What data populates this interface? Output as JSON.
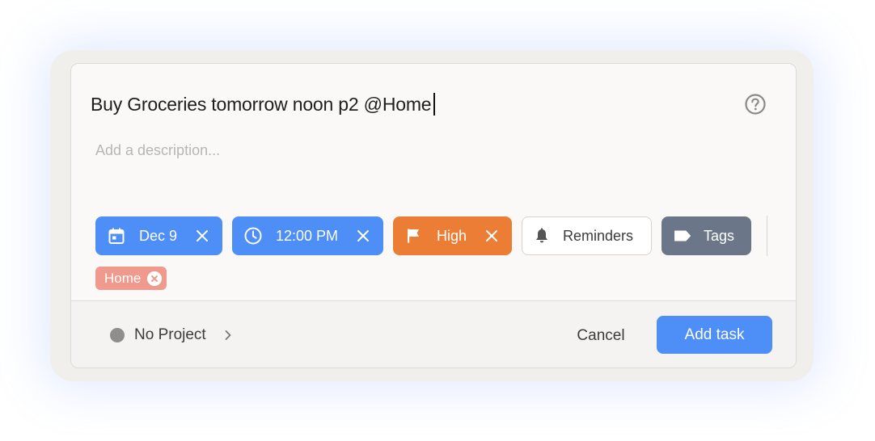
{
  "task": {
    "title": "Buy Groceries tomorrow noon p2 @Home",
    "description_placeholder": "Add a description..."
  },
  "chips": {
    "date": {
      "label": "Dec 9",
      "icon": "calendar-icon"
    },
    "time": {
      "label": "12:00 PM",
      "icon": "clock-icon"
    },
    "priority": {
      "label": "High",
      "icon": "flag-icon"
    },
    "reminders": {
      "label": "Reminders",
      "icon": "bell-icon"
    },
    "tags": {
      "label": "Tags",
      "icon": "tag-icon"
    }
  },
  "labels": {
    "home": "Home"
  },
  "footer": {
    "project_label": "No Project",
    "cancel_label": "Cancel",
    "add_label": "Add task"
  },
  "colors": {
    "accent_blue": "#4d8ef7",
    "priority_high": "#ec7d35",
    "tags_gray": "#6b7789",
    "label_home": "#f09a8e",
    "project_dot": "#8e8e8e"
  }
}
